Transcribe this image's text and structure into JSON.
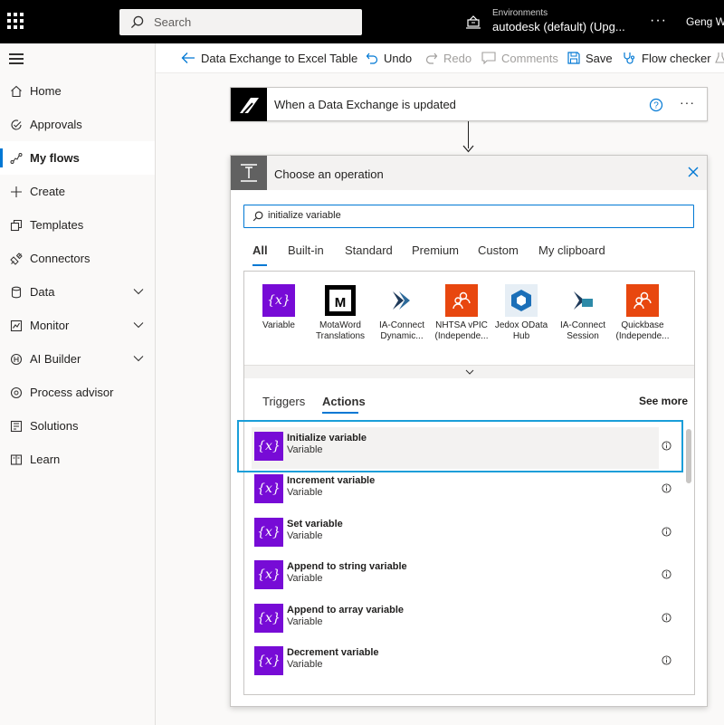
{
  "topbar": {
    "search_placeholder": "Search",
    "environments_label": "Environments",
    "environment_value": "autodesk (default) (Upg...",
    "more": "···",
    "user": "Geng Wa"
  },
  "sidebar": {
    "items": [
      {
        "label": "Home",
        "icon": "home-icon"
      },
      {
        "label": "Approvals",
        "icon": "approvals-icon"
      },
      {
        "label": "My flows",
        "icon": "flows-icon",
        "active": true
      },
      {
        "label": "Create",
        "icon": "plus-icon"
      },
      {
        "label": "Templates",
        "icon": "templates-icon"
      },
      {
        "label": "Connectors",
        "icon": "connectors-icon"
      },
      {
        "label": "Data",
        "icon": "database-icon",
        "expandable": true
      },
      {
        "label": "Monitor",
        "icon": "monitor-icon",
        "expandable": true
      },
      {
        "label": "AI Builder",
        "icon": "ai-builder-icon",
        "expandable": true
      },
      {
        "label": "Process advisor",
        "icon": "process-advisor-icon"
      },
      {
        "label": "Solutions",
        "icon": "solutions-icon"
      },
      {
        "label": "Learn",
        "icon": "learn-icon"
      }
    ]
  },
  "cmdbar": {
    "flow_name": "Data Exchange to Excel Table",
    "undo": "Undo",
    "redo": "Redo",
    "comments": "Comments",
    "save": "Save",
    "flow_checker": "Flow checker"
  },
  "trigger": {
    "title": "When a Data Exchange is updated",
    "more": "···"
  },
  "panel": {
    "title": "Choose an operation",
    "search_value": "initialize variable",
    "tabs": [
      "All",
      "Built-in",
      "Standard",
      "Premium",
      "Custom",
      "My clipboard"
    ],
    "active_tab": "All",
    "connectors": [
      {
        "name": "Variable",
        "color": "#770bd6",
        "icon": "variable-icon"
      },
      {
        "name": "MotaWord\nTranslations",
        "color": "#ffffff",
        "icon": "motaword-icon"
      },
      {
        "name": "IA-Connect\nDynamic...",
        "color": "#ffffff",
        "icon": "ia-connect-icon"
      },
      {
        "name": "NHTSA vPIC\n(Independe...",
        "color": "#e8470f",
        "icon": "people-icon"
      },
      {
        "name": "Jedox OData\nHub",
        "color": "#e6eef5",
        "icon": "jedox-icon"
      },
      {
        "name": "IA-Connect\nSession",
        "color": "#ffffff",
        "icon": "ia-session-icon"
      },
      {
        "name": "Quickbase\n(Independe...",
        "color": "#e8470f",
        "icon": "people-icon"
      }
    ],
    "sub_tabs": [
      "Triggers",
      "Actions"
    ],
    "active_sub_tab": "Actions",
    "see_more": "See more",
    "actions": [
      {
        "name": "Initialize variable",
        "sub": "Variable",
        "selected": true
      },
      {
        "name": "Increment variable",
        "sub": "Variable"
      },
      {
        "name": "Set variable",
        "sub": "Variable"
      },
      {
        "name": "Append to string variable",
        "sub": "Variable"
      },
      {
        "name": "Append to array variable",
        "sub": "Variable"
      },
      {
        "name": "Decrement variable",
        "sub": "Variable"
      }
    ]
  },
  "colors": {
    "accent": "#0078d4",
    "variable_purple": "#770bd6",
    "highlight": "#1a9ed9"
  }
}
